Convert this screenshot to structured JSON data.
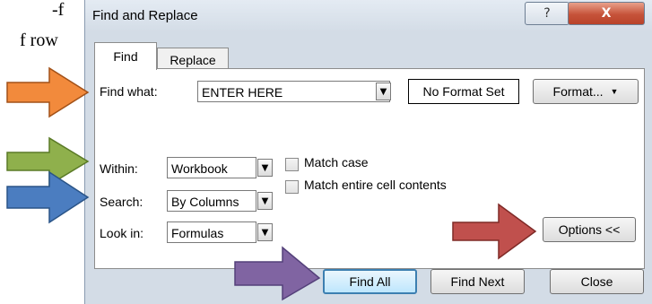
{
  "background_text": {
    "line1": "-f",
    "line2": "f row"
  },
  "dialog": {
    "title": "Find and Replace",
    "help_label": "?",
    "close_label": "X"
  },
  "tabs": [
    {
      "label": "Find",
      "active": true
    },
    {
      "label": "Replace",
      "active": false
    }
  ],
  "find": {
    "find_what_label": "Find what:",
    "find_what_value": "ENTER HERE",
    "format_status": "No Format Set",
    "format_button": "Format...",
    "within_label": "Within:",
    "within_value": "Workbook",
    "search_label": "Search:",
    "search_value": "By Columns",
    "lookin_label": "Look in:",
    "lookin_value": "Formulas",
    "match_case_label": "Match case",
    "match_case_checked": false,
    "match_entire_label": "Match entire cell contents",
    "match_entire_checked": false,
    "options_button": "Options <<"
  },
  "buttons": {
    "find_all": "Find All",
    "find_next": "Find Next",
    "close": "Close"
  },
  "arrow_colors": {
    "orange": "#f28a3c",
    "green": "#8fb04c",
    "blue": "#4b7dc0",
    "red": "#c0504d",
    "purple": "#8064a2"
  }
}
